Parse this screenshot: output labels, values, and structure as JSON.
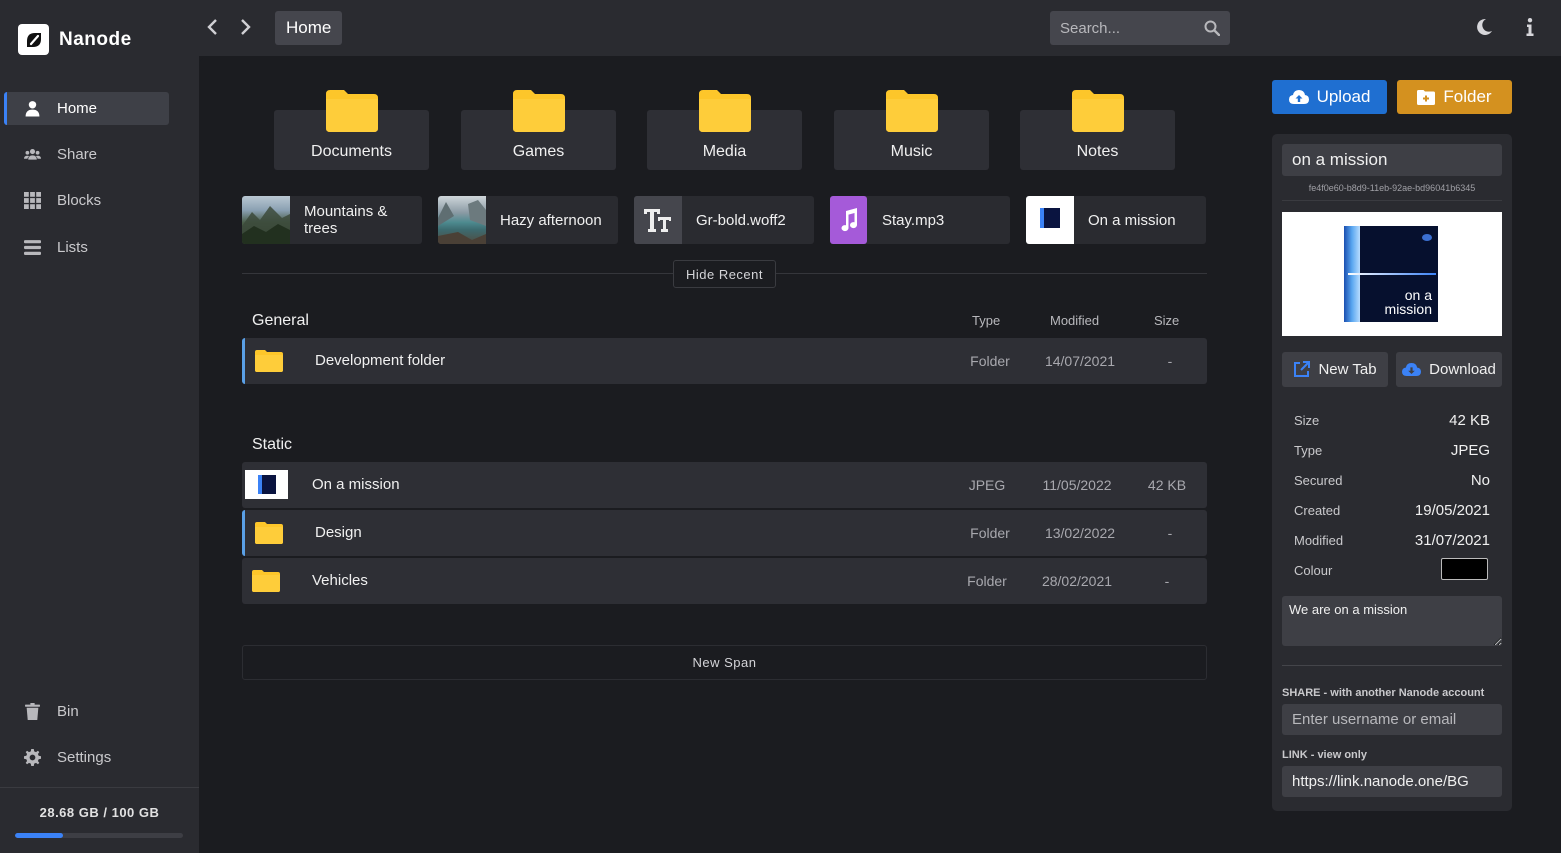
{
  "app": {
    "name": "Nanode"
  },
  "sidebar": {
    "items": [
      {
        "label": "Home",
        "icon": "user-icon"
      },
      {
        "label": "Share",
        "icon": "users-icon"
      },
      {
        "label": "Blocks",
        "icon": "grid-icon"
      },
      {
        "label": "Lists",
        "icon": "list-icon"
      }
    ],
    "bottom_items": [
      {
        "label": "Bin",
        "icon": "trash-icon"
      },
      {
        "label": "Settings",
        "icon": "gear-icon"
      }
    ],
    "storage": {
      "text": "28.68 GB  /  100 GB",
      "used_fraction": 0.2868
    }
  },
  "topbar": {
    "breadcrumb": "Home",
    "search_placeholder": "Search..."
  },
  "folders": [
    "Documents",
    "Games",
    "Media",
    "Music",
    "Notes"
  ],
  "recent": [
    {
      "label": "Mountains & trees",
      "thumb": "mountain-photo"
    },
    {
      "label": "Hazy afternoon",
      "thumb": "lake-photo"
    },
    {
      "label": "Gr-bold.woff2",
      "thumb": "font-icon"
    },
    {
      "label": "Stay.mp3",
      "thumb": "music-icon"
    },
    {
      "label": "On a mission",
      "thumb": "mission-image"
    }
  ],
  "hide_recent_label": "Hide Recent",
  "columns": {
    "type": "Type",
    "modified": "Modified",
    "size": "Size"
  },
  "spans": [
    {
      "title": "General",
      "rows": [
        {
          "name": "Development folder",
          "type": "Folder",
          "modified": "14/07/2021",
          "size": "-"
        }
      ]
    },
    {
      "title": "Static",
      "rows": [
        {
          "name": "On a mission",
          "type": "JPEG",
          "modified": "11/05/2022",
          "size": "42 KB"
        },
        {
          "name": "Design",
          "type": "Folder",
          "modified": "13/02/2022",
          "size": "-"
        },
        {
          "name": "Vehicles",
          "type": "Folder",
          "modified": "28/02/2021",
          "size": "-"
        }
      ]
    }
  ],
  "new_span_label": "New Span",
  "actions": {
    "upload": "Upload",
    "folder": "Folder"
  },
  "details": {
    "name": "on a mission",
    "id": "fe4f0e60-b8d9-11eb-92ae-bd96041b6345",
    "preview_text": "on a\nmission",
    "new_tab": "New Tab",
    "download": "Download",
    "props": [
      {
        "label": "Size",
        "value": "42 KB"
      },
      {
        "label": "Type",
        "value": "JPEG"
      },
      {
        "label": "Secured",
        "value": "No"
      },
      {
        "label": "Created",
        "value": "19/05/2021"
      },
      {
        "label": "Modified",
        "value": "31/07/2021"
      },
      {
        "label": "Colour",
        "value": ""
      }
    ],
    "colour": "#000000",
    "description": "We are on a mission",
    "share_label": "SHARE - with another Nanode account",
    "share_placeholder": "Enter username or email",
    "link_label": "LINK - view only",
    "link_value": "https://link.nanode.one/BG"
  },
  "colors": {
    "accent": "#3b82f6",
    "folder": "#fdc62a",
    "upload": "#1f6fd1",
    "folder_button": "#d4911f"
  }
}
